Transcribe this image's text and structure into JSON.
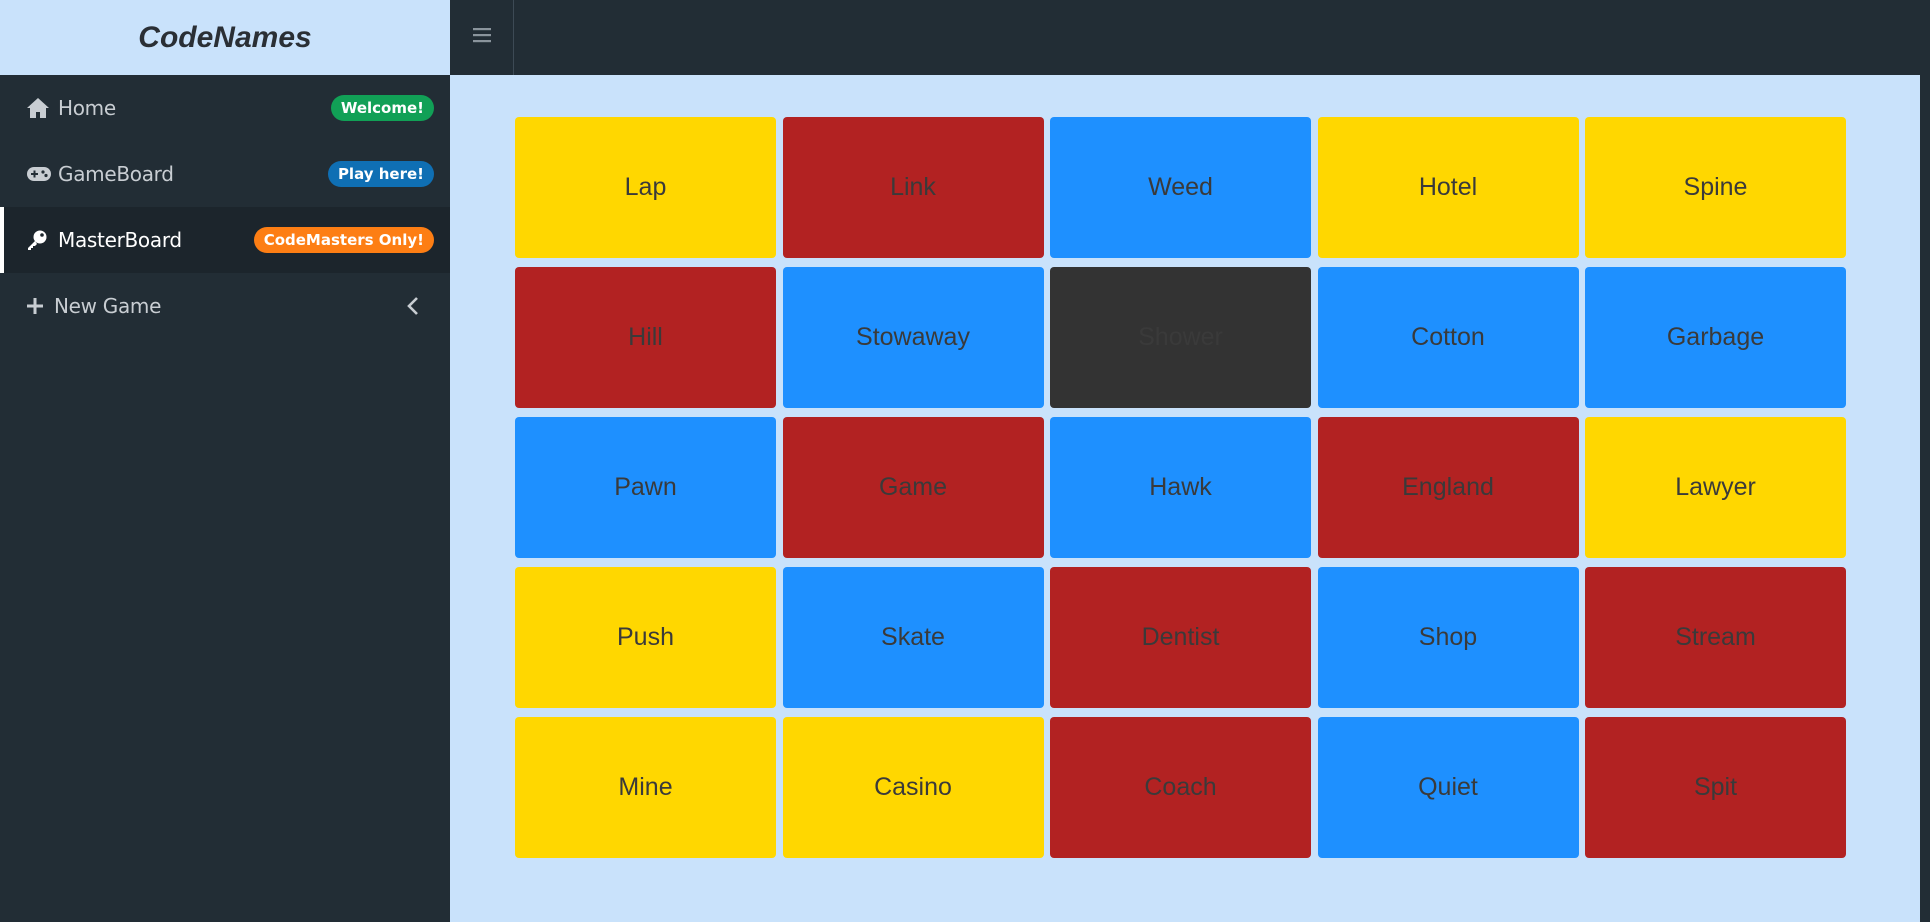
{
  "app": {
    "title": "CodeNames"
  },
  "sidebar": {
    "items": [
      {
        "label": "Home",
        "icon": "home-icon",
        "badge": "Welcome!",
        "badge_color": "#11a056",
        "active": false
      },
      {
        "label": "GameBoard",
        "icon": "gamepad-icon",
        "badge": "Play here!",
        "badge_color": "#0f6fb4",
        "active": false
      },
      {
        "label": "MasterBoard",
        "icon": "key-icon",
        "badge": "CodeMasters Only!",
        "badge_color": "#fd7e14",
        "active": true
      },
      {
        "label": "New Game",
        "icon": "plus-icon",
        "badge": "",
        "active": false
      }
    ]
  },
  "colors": {
    "yellow": "#ffd700",
    "red": "#b22222",
    "blue": "#1e90ff",
    "black": "#333333",
    "sidebar_bg": "#222d35",
    "page_bg": "#c9e2fb"
  },
  "board": {
    "cards": [
      {
        "word": "Lap",
        "team": "yellow"
      },
      {
        "word": "Link",
        "team": "red"
      },
      {
        "word": "Weed",
        "team": "blue"
      },
      {
        "word": "Hotel",
        "team": "yellow"
      },
      {
        "word": "Spine",
        "team": "yellow"
      },
      {
        "word": "Hill",
        "team": "red"
      },
      {
        "word": "Stowaway",
        "team": "blue"
      },
      {
        "word": "Shower",
        "team": "black"
      },
      {
        "word": "Cotton",
        "team": "blue"
      },
      {
        "word": "Garbage",
        "team": "blue"
      },
      {
        "word": "Pawn",
        "team": "blue"
      },
      {
        "word": "Game",
        "team": "red"
      },
      {
        "word": "Hawk",
        "team": "blue"
      },
      {
        "word": "England",
        "team": "red"
      },
      {
        "word": "Lawyer",
        "team": "yellow"
      },
      {
        "word": "Push",
        "team": "yellow"
      },
      {
        "word": "Skate",
        "team": "blue"
      },
      {
        "word": "Dentist",
        "team": "red"
      },
      {
        "word": "Shop",
        "team": "blue"
      },
      {
        "word": "Stream",
        "team": "red"
      },
      {
        "word": "Mine",
        "team": "yellow"
      },
      {
        "word": "Casino",
        "team": "yellow"
      },
      {
        "word": "Coach",
        "team": "red"
      },
      {
        "word": "Quiet",
        "team": "blue"
      },
      {
        "word": "Spit",
        "team": "red"
      }
    ]
  }
}
